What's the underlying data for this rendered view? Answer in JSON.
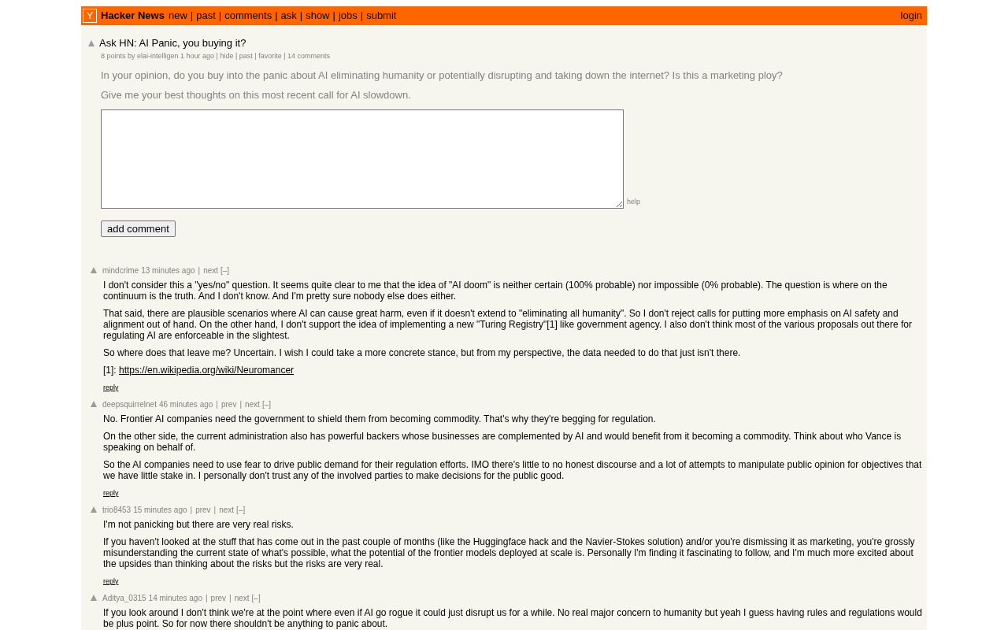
{
  "header": {
    "logo": "Y",
    "site_name": "Hacker News",
    "separator": "|",
    "nav": [
      "new",
      "past",
      "comments",
      "ask",
      "show",
      "jobs",
      "submit"
    ],
    "login": "login"
  },
  "story": {
    "title": "Ask HN: AI Panic, you buying it?",
    "subtext": "8 points by elai-intelligen 1 hour ago | hide | past | favorite | 14 comments",
    "paragraphs": [
      "In your opinion, do you buy into the panic about AI eliminating humanity or potentially disrupting and taking down the internet? Is this a marketing ploy?",
      "Give me your best thoughts on this most recent call for AI slowdown."
    ]
  },
  "comment_form": {
    "help": "help",
    "button": "add comment"
  },
  "comments": [
    {
      "user": "mindcrime",
      "age": "13 minutes ago",
      "links": [
        "next"
      ],
      "toggle": "[–]",
      "paragraphs": [
        {
          "text": "I don't consider this a \"yes/no\" question. It seems quite clear to me that the idea of \"AI doom\" is neither certain (100% probable) nor impossible (0% probable). The question is where on the continuum is the truth. And I don't know. And I'm pretty sure nobody else does either."
        },
        {
          "text": "That said, there are plausible scenarios where AI can cause great harm, even if it doesn't extend to \"eliminating all humanity\". So I don't reject calls for putting more emphasis on AI safety and alignment out of hand. On the other hand, I don't support the idea of implementing a new \"Turing Registry\"[1] like government agency. I also don't think most of the various proposals out there for regulating AI are enforceable in the slightest."
        },
        {
          "text": "So where does that leave me? Uncertain. I wish I could take a more concrete stance, but from my perspective, the data needed to do that just isn't there."
        },
        {
          "text": "[1]: ",
          "link": "https://en.wikipedia.org/wiki/Neuromancer"
        }
      ],
      "reply": "reply"
    },
    {
      "user": "deepsquirrelnet",
      "age": "46 minutes ago",
      "links": [
        "prev",
        "next"
      ],
      "toggle": "[–]",
      "paragraphs": [
        {
          "text": "No. Frontier AI companies need the government to shield them from becoming commodity. That's why they're begging for regulation."
        },
        {
          "text": "On the other side, the current administration also has powerful backers whose businesses are complemented by AI and would benefit from it becoming a commodity. Think about who Vance is speaking on behalf of."
        },
        {
          "text": "So the AI companies need to use fear to drive public demand for their regulation efforts. IMO there's little to no honest discourse and a lot of attempts to manipulate public opinion for objectives that we have little stake in. I personally don't trust any of the involved parties to make decisions for the public good."
        }
      ],
      "reply": "reply"
    },
    {
      "user": "trio8453",
      "age": "15 minutes ago",
      "links": [
        "prev",
        "next"
      ],
      "toggle": "[–]",
      "paragraphs": [
        {
          "text": "I'm not panicking but there are very real risks."
        },
        {
          "text": "If you haven't looked at the stuff that has come out in the past couple of months (like the Huggingface hack and the Navier-Stokes solution) and/or you're dismissing it as marketing, you're grossly misunderstanding the current state of what's possible, what the potential of the frontier models deployed at scale is. Personally I'm finding it fascinating to follow, and I'm much more excited about the upsides than thinking about the risks but the risks are very real."
        }
      ],
      "reply": "reply"
    },
    {
      "user": "Aditya_0315",
      "age": "14 minutes ago",
      "links": [
        "prev",
        "next"
      ],
      "toggle": "[–]",
      "paragraphs": [
        {
          "text": "If you look around I don't think we're at the point where even if AI go rogue it could just disrupt us for a while. No real major concern to humanity but yeah I guess having rules and regulations would be plus point. So for now there shouldn't be anything to panic about."
        }
      ]
    }
  ]
}
